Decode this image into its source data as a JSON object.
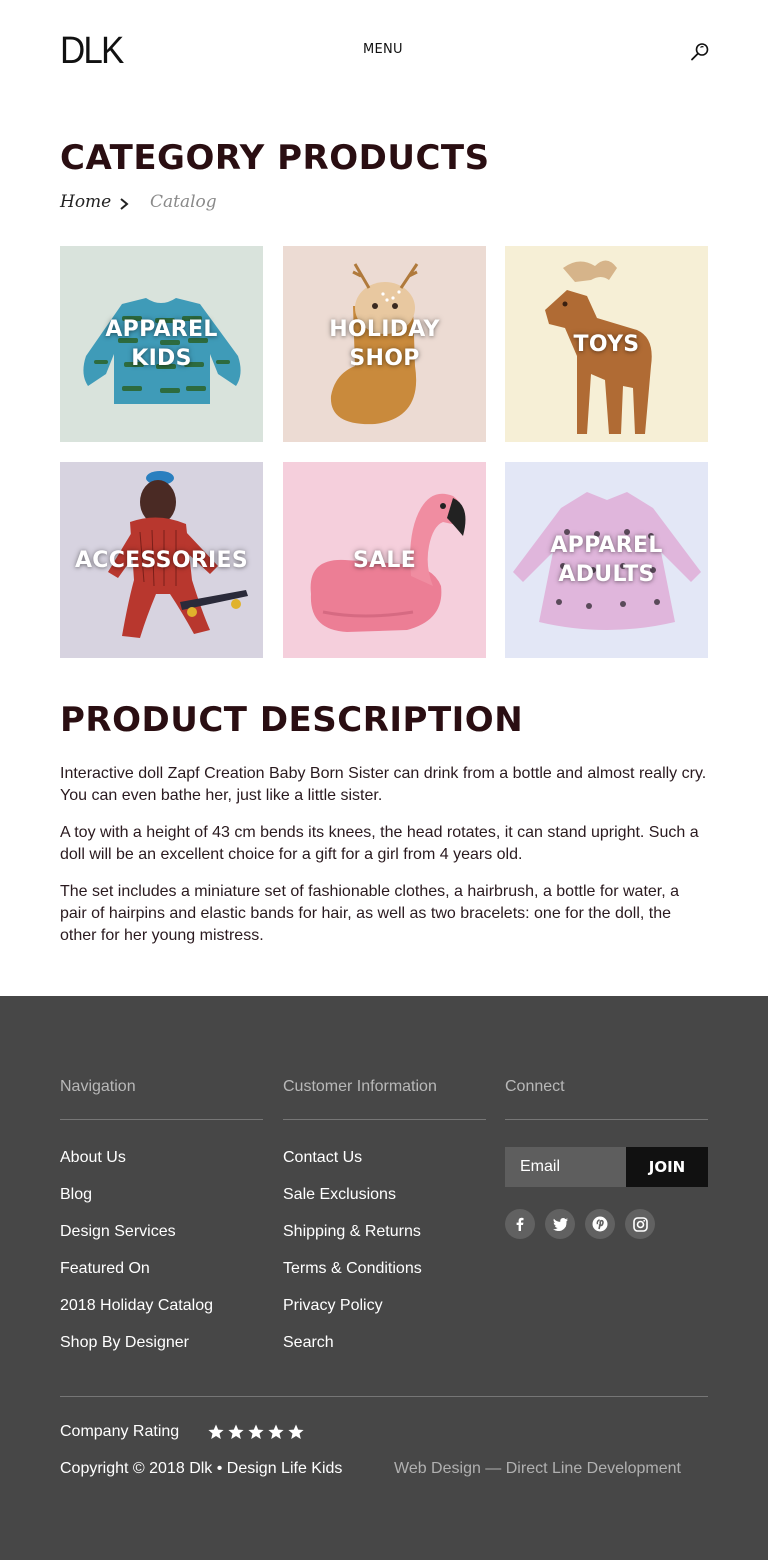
{
  "header": {
    "logo": "DLK",
    "menu_label": "MENU"
  },
  "page": {
    "title": "CATEGORY PRODUCTS",
    "breadcrumb": {
      "home": "Home",
      "current": "Catalog"
    }
  },
  "categories": [
    {
      "label": "APPAREL\nKIDS",
      "bg": "#d9e3dc"
    },
    {
      "label": "HOLIDAY\nSHOP",
      "bg": "#ecdbd3"
    },
    {
      "label": "TOYS",
      "bg": "#f6efd6"
    },
    {
      "label": "ACCESSORIES",
      "bg": "#d7d3e0"
    },
    {
      "label": "SALE",
      "bg": "#f5cfdc"
    },
    {
      "label": "APPAREL\nADULTS",
      "bg": "#e3e7f6"
    }
  ],
  "description": {
    "title": "PRODUCT DESCRIPTION",
    "paragraphs": [
      "Interactive doll Zapf Creation Baby Born Sister can drink from a bottle and almost really cry. You can even bathe her, just like a little sister.",
      "A toy with a height of 43 cm bends its knees, the head rotates, it can stand upright. Such a doll will be an excellent choice for a gift for a girl from 4 years old.",
      "The set includes a miniature set of fashionable clothes, a hairbrush, a bottle for water, a pair of hairpins and elastic bands for hair, as well as two bracelets: one for the doll, the other for her young mistress."
    ]
  },
  "footer": {
    "navigation": {
      "heading": "Navigation",
      "items": [
        "About Us",
        "Blog",
        "Design Services",
        "Featured On",
        "2018 Holiday Catalog",
        "Shop By Designer"
      ]
    },
    "customer_info": {
      "heading": "Customer Information",
      "items": [
        "Contact Us",
        "Sale Exclusions",
        "Shipping & Returns",
        "Terms & Conditions",
        "Privacy Policy",
        "Search"
      ]
    },
    "connect": {
      "heading": "Connect",
      "email_placeholder": "Email",
      "join_label": "JOIN",
      "socials": [
        "facebook-icon",
        "twitter-icon",
        "pinterest-icon",
        "instagram-icon"
      ]
    },
    "rating": {
      "label": "Company Rating",
      "stars": 5
    },
    "copyright": "Copyright © 2018 Dlk • Design Life Kids",
    "credit": "Web Design — Direct Line Development",
    "colors": {
      "background": "#474747",
      "button": "#111111"
    }
  }
}
